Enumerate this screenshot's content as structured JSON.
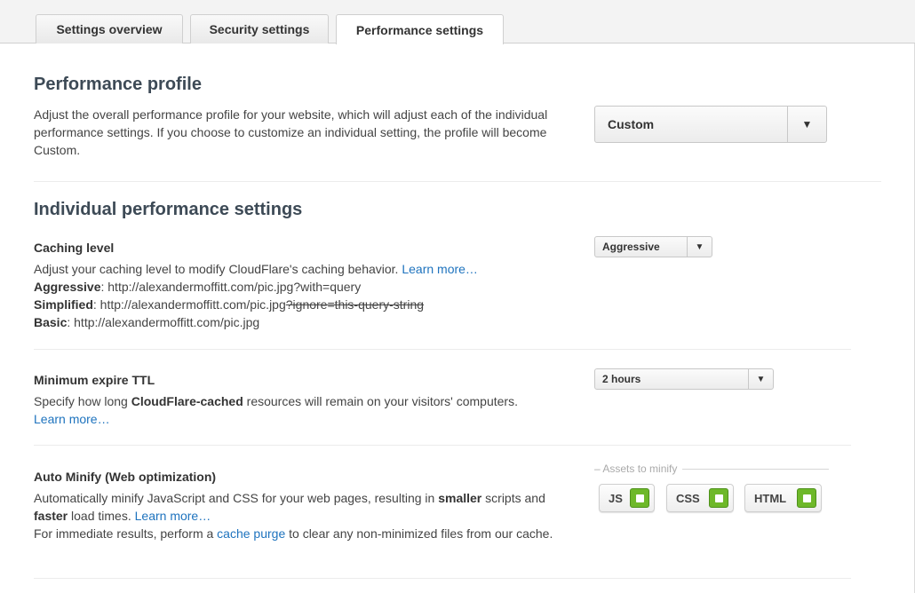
{
  "tabs": [
    {
      "label": "Settings overview"
    },
    {
      "label": "Security settings"
    },
    {
      "label": "Performance settings"
    }
  ],
  "profile": {
    "heading": "Performance profile",
    "description": "Adjust the overall performance profile for your website, which will adjust each of the individual performance settings. If you choose to customize an individual setting, the profile will become Custom.",
    "selected": "Custom"
  },
  "individual": {
    "heading": "Individual performance settings"
  },
  "caching": {
    "title": "Caching level",
    "description": "Adjust your caching level to modify CloudFlare's caching behavior.",
    "learn_more": "Learn more…",
    "aggressive_label": "Aggressive",
    "aggressive_url": ": http://alexandermoffitt.com/pic.jpg?with=query",
    "simplified_label": "Simplified",
    "simplified_url": ": http://alexandermoffitt.com/pic.jpg",
    "simplified_struck": "?ignore=this-query-string",
    "basic_label": "Basic",
    "basic_url": ": http://alexandermoffitt.com/pic.jpg",
    "selected": "Aggressive"
  },
  "ttl": {
    "title": "Minimum expire TTL",
    "desc_before": "Specify how long ",
    "desc_bold": "CloudFlare-cached",
    "desc_after": " resources will remain on your visitors' computers.",
    "learn_more": "Learn more…",
    "selected": "2 hours"
  },
  "minify": {
    "title": "Auto Minify (Web optimization)",
    "desc_1": "Automatically minify JavaScript and CSS for your web pages, resulting in ",
    "desc_bold_1": "smaller",
    "desc_2": " scripts and ",
    "desc_bold_2": "faster",
    "desc_3": " load times. ",
    "learn_more": "Learn more…",
    "desc_4": "For immediate results, perform a ",
    "purge_link": "cache purge",
    "desc_5": " to clear any non-minimized files from our cache.",
    "assets_label": "– Assets to minify",
    "toggles": [
      {
        "label": "JS",
        "checked": true
      },
      {
        "label": "CSS",
        "checked": true
      },
      {
        "label": "HTML",
        "checked": true
      }
    ],
    "check_color": "#6eb829"
  }
}
